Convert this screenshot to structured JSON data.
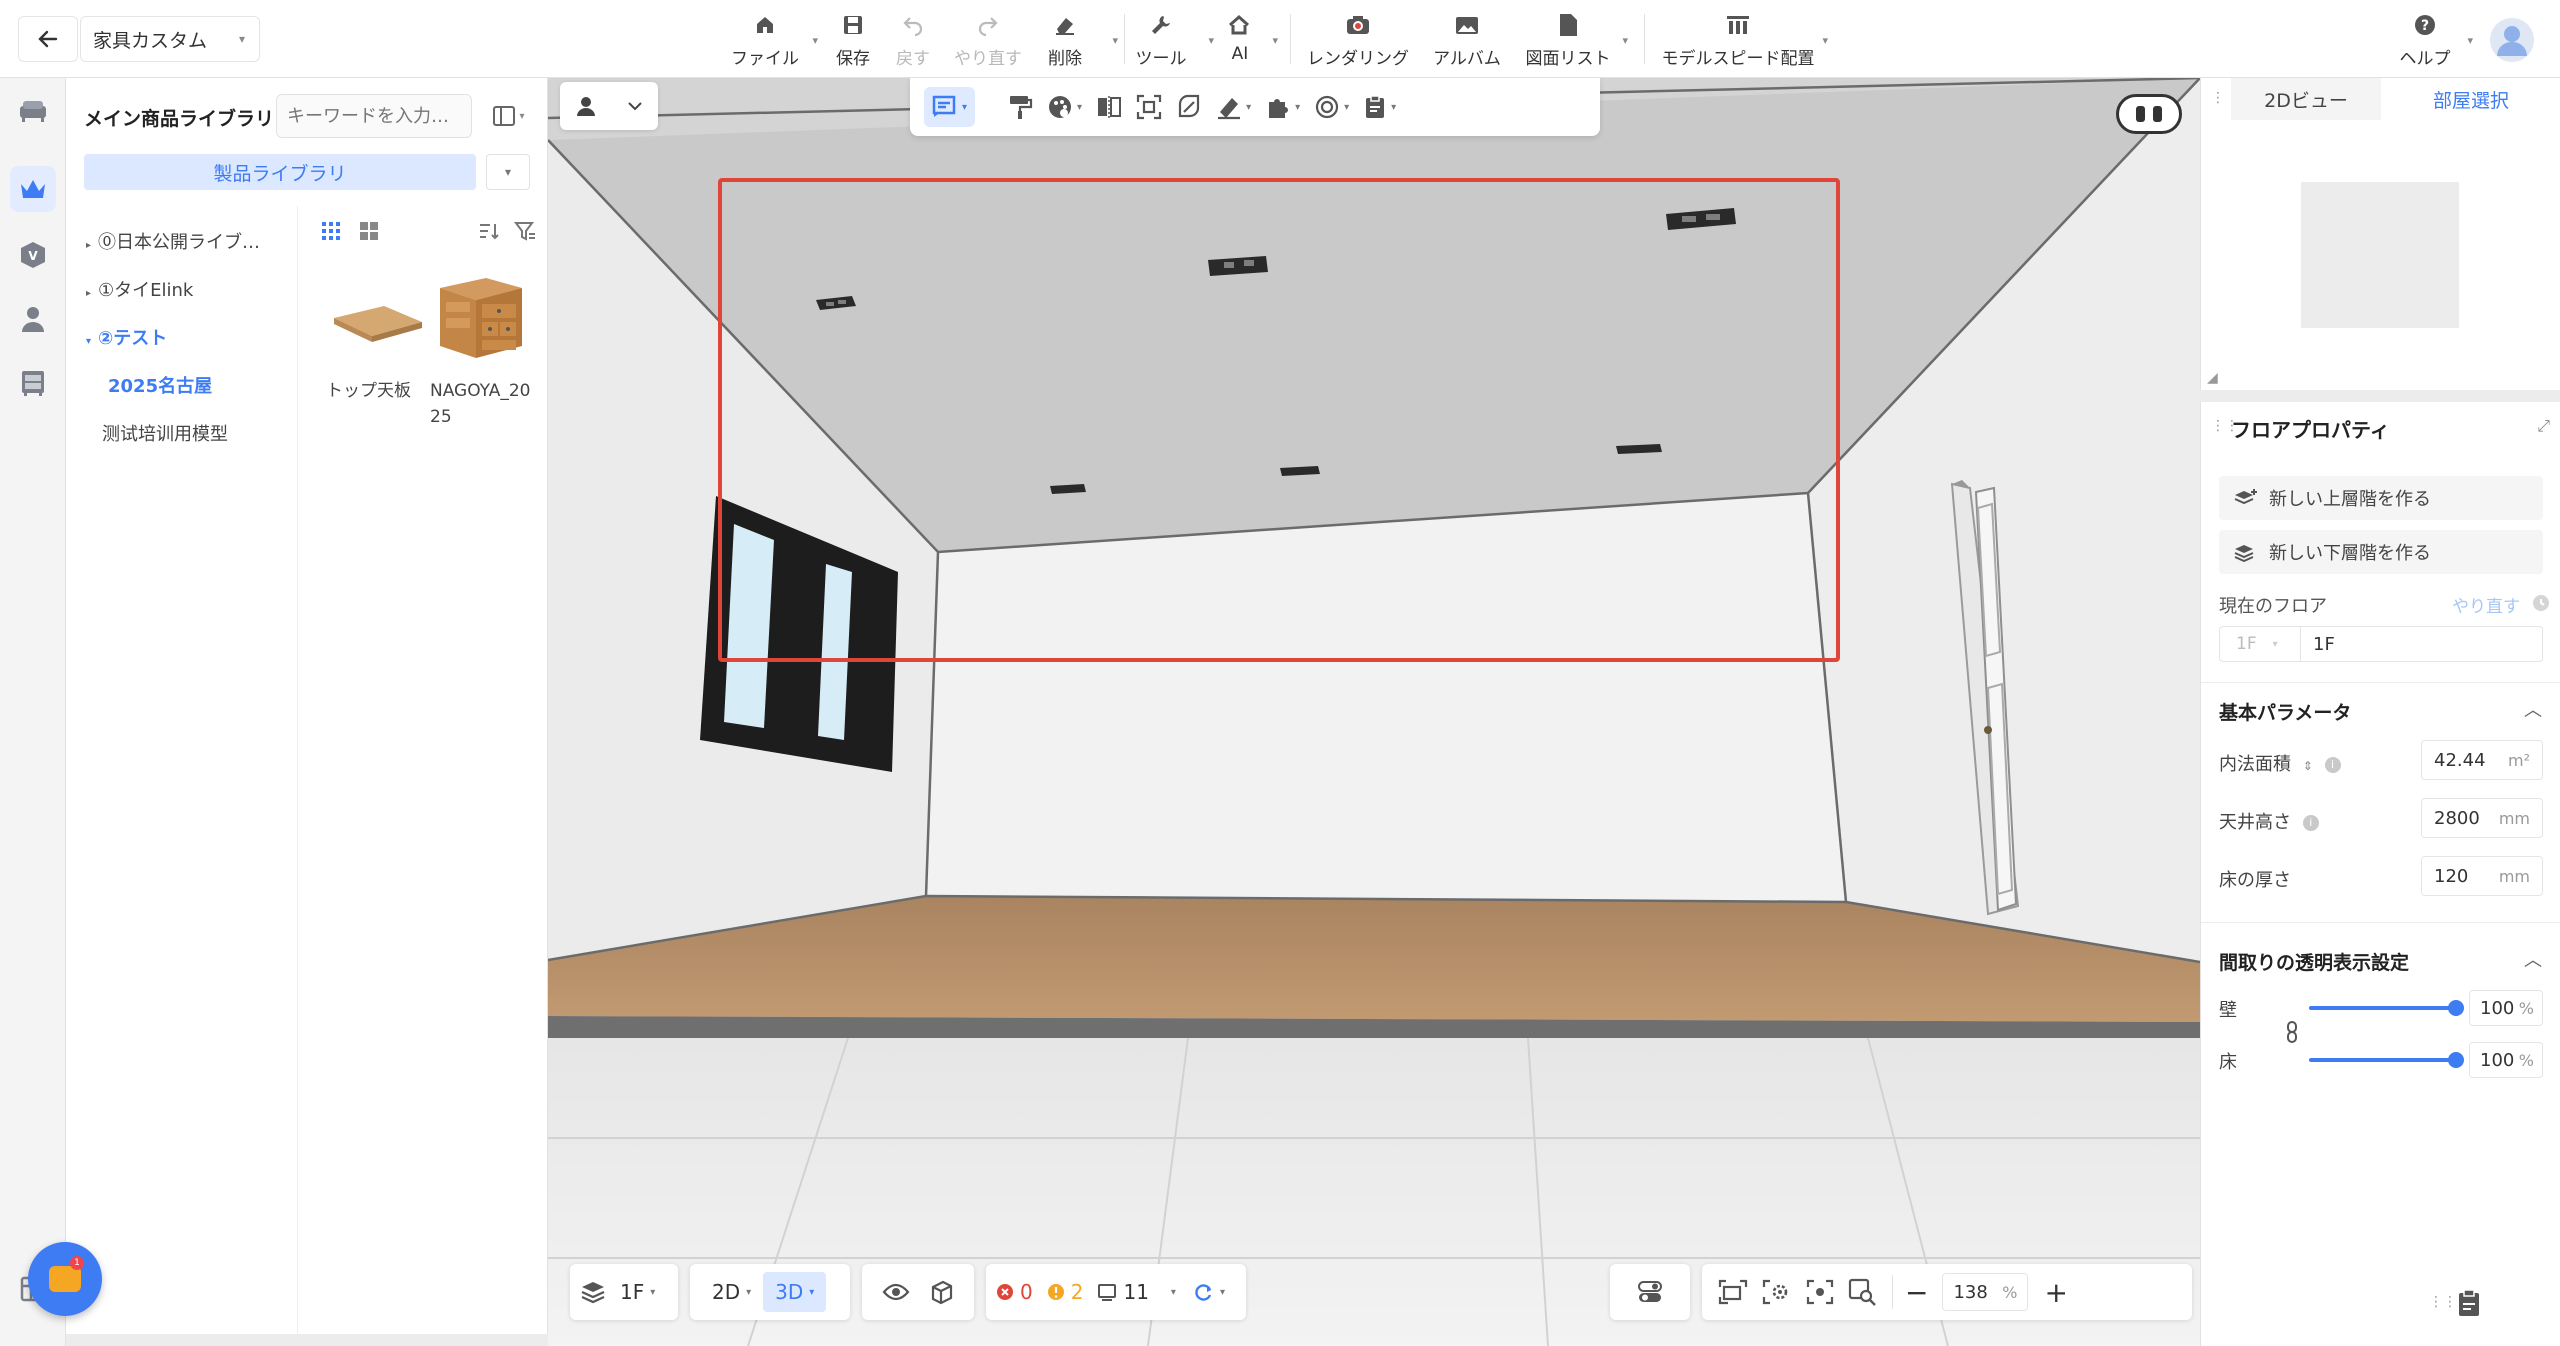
{
  "topbar": {
    "project_name": "家具カスタム",
    "buttons": {
      "file": "ファイル",
      "save": "保存",
      "undo": "戻す",
      "redo": "やり直す",
      "delete": "削除",
      "tools": "ツール",
      "ai": "AI",
      "rendering": "レンダリング",
      "album": "アルバム",
      "drawing_list": "図面リスト",
      "model_speed": "モデルスピード配置",
      "help": "ヘルプ"
    }
  },
  "library": {
    "title": "メイン商品ライブラリ",
    "search_placeholder": "キーワードを入力…",
    "tab_label": "製品ライブラリ",
    "tree": [
      {
        "label": "⓪日本公開ライブ…",
        "expanded": false
      },
      {
        "label": "①タイElink",
        "expanded": false
      },
      {
        "label": "②テスト",
        "expanded": true
      },
      {
        "label": "2025名古屋",
        "selected": true
      },
      {
        "label": "测试培训用模型"
      }
    ],
    "products": [
      {
        "name": "トップ天板",
        "icon": "wood-board"
      },
      {
        "name": "NAGOYA_2025",
        "icon": "wood-drawer-cabinet"
      }
    ]
  },
  "viewport": {
    "floor_label": "1F",
    "mode_2d": "2D",
    "mode_3d": "3D",
    "errors": "0",
    "warnings": "2",
    "items": "11",
    "zoom": "138",
    "zoom_unit": "%"
  },
  "right_top": {
    "tab_2d": "2Dビュー",
    "tab_room": "部屋選択"
  },
  "props": {
    "title": "フロアプロパティ",
    "new_upper": "新しい上層階を作る",
    "new_lower": "新しい下層階を作る",
    "current_floor_label": "現在のフロア",
    "redo_link": "やり直す",
    "floor_select": "1F",
    "floor_name": "1F",
    "basic_params_title": "基本パラメータ",
    "inner_area_label": "内法面積",
    "inner_area_value": "42.44",
    "inner_area_unit": "m²",
    "ceiling_height_label": "天井高さ",
    "ceiling_height_value": "2800",
    "ceiling_height_unit": "mm",
    "floor_thickness_label": "床の厚さ",
    "floor_thickness_value": "120",
    "floor_thickness_unit": "mm",
    "transparency_title": "間取りの透明表示設定",
    "wall_label": "壁",
    "wall_value": "100",
    "floor_label": "床",
    "floor_value": "100",
    "pct_unit": "%"
  },
  "colors": {
    "accent": "#3d7cf2",
    "selection_rect": "#e0453a",
    "floor_wood": "#b68c64"
  }
}
